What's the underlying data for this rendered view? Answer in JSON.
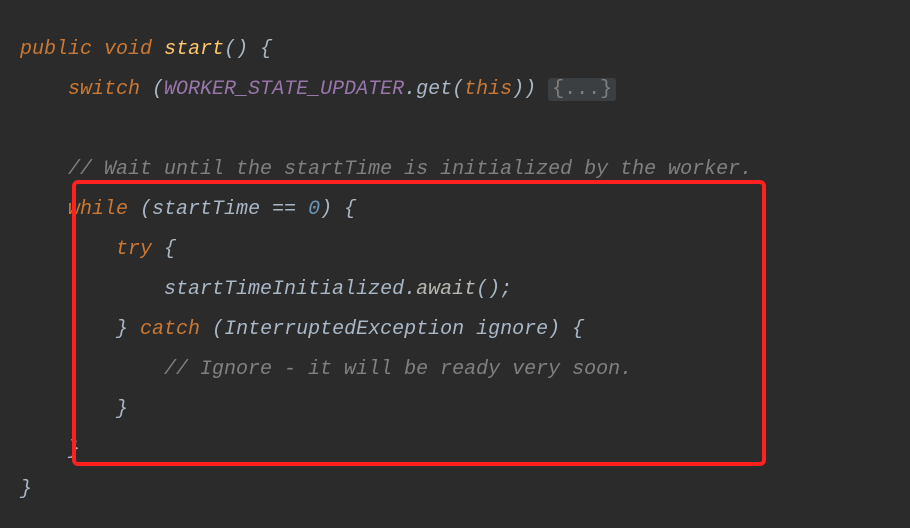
{
  "code": {
    "line1": {
      "kw_public": "public",
      "kw_void": "void",
      "method": "start",
      "parens": "()",
      "brace_open": " {"
    },
    "line2": {
      "indent": "    ",
      "kw_switch": "switch",
      "paren_open": " (",
      "const_name": "WORKER_STATE_UPDATER",
      "dot_get": ".get(",
      "this_kw": "this",
      "close": ")) ",
      "folded": "{...}"
    },
    "line3": {
      "indent": "    ",
      "comment": "// Wait until the startTime is initialized by the worker."
    },
    "line4": {
      "indent": "    ",
      "kw_while": "while",
      "paren_open": " (",
      "var": "startTime",
      "eq": " == ",
      "zero": "0",
      "close": ") {"
    },
    "line5": {
      "indent": "        ",
      "kw_try": "try",
      "brace": " {"
    },
    "line6": {
      "indent": "            ",
      "obj": "startTimeInitialized",
      "dot": ".",
      "await": "await",
      "parens": "();"
    },
    "line7": {
      "indent": "        ",
      "brace_close": "}",
      "kw_catch": " catch ",
      "paren_open": "(",
      "exception": "InterruptedException ignore",
      "close": ") {"
    },
    "line8": {
      "indent": "            ",
      "comment": "// Ignore - it will be ready very soon."
    },
    "line9": {
      "indent": "        ",
      "brace": "}"
    },
    "line10": {
      "indent": "    ",
      "brace": "}"
    },
    "line11": {
      "brace": "}"
    }
  }
}
